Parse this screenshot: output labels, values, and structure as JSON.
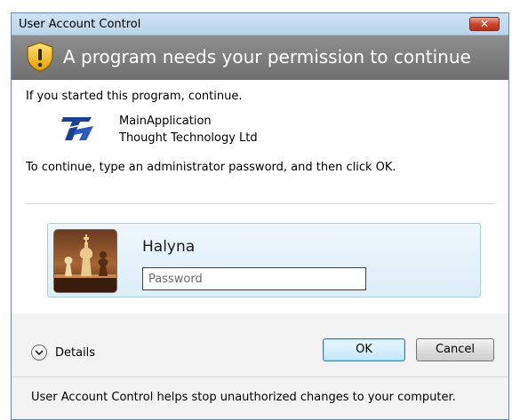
{
  "window": {
    "title": "User Account Control",
    "close_glyph": "✕"
  },
  "banner": {
    "icon": "shield-warning-icon",
    "text": "A program needs your permission to continue"
  },
  "content": {
    "intro": "If you started this program, continue.",
    "app_icon": "thought-technology-logo-icon",
    "app_name": "MainApplication",
    "publisher": "Thought Technology Ltd",
    "instruction": "To continue, type an administrator password, and then click OK."
  },
  "user": {
    "name": "Halyna",
    "avatar": "chess-pieces-avatar",
    "password_placeholder": "Password",
    "password_value": ""
  },
  "actions": {
    "details_label": "Details",
    "ok_label": "OK",
    "cancel_label": "Cancel"
  },
  "footer": {
    "text": "User Account Control helps stop unauthorized changes to your computer."
  },
  "colors": {
    "banner": "#7f7f7f",
    "tile_border": "#a8cfe6",
    "ok_border": "#3c7fb1"
  }
}
